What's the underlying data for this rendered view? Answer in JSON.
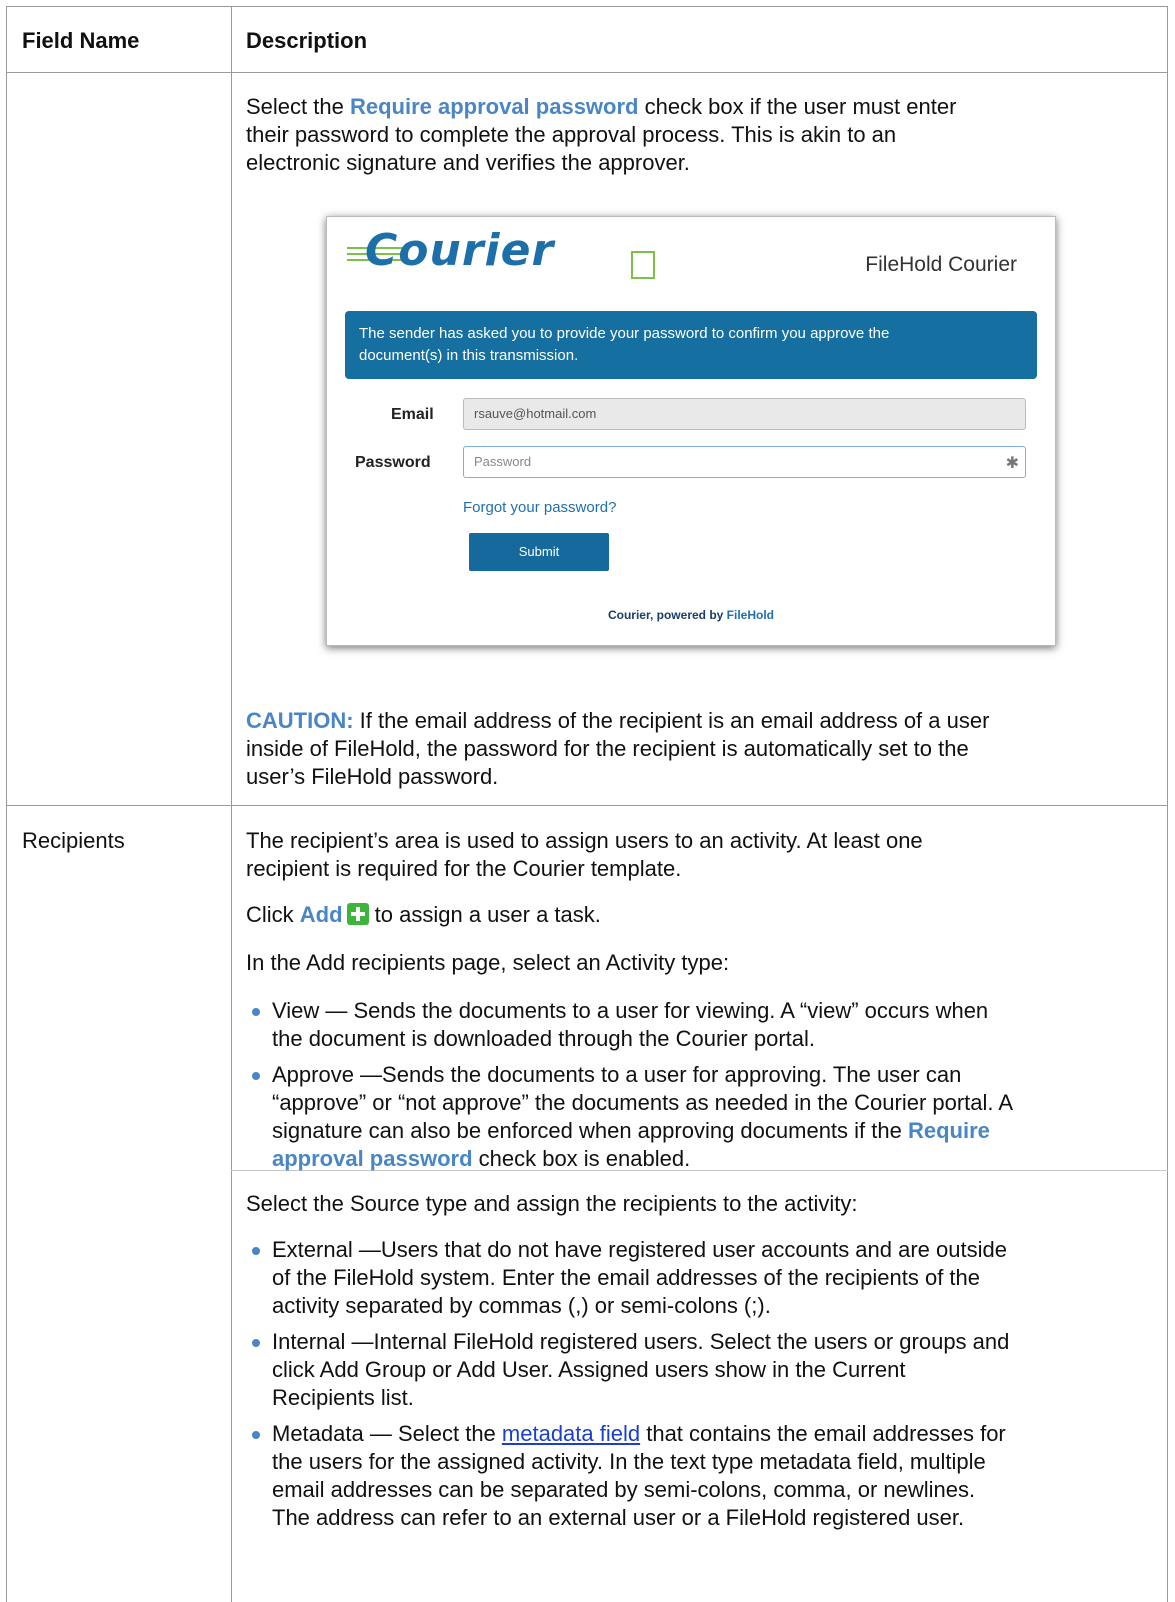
{
  "header": {
    "col1": "Field Name",
    "col2": "Description"
  },
  "row1": {
    "p1_pre": "Select the ",
    "p1_b1": "Require approval password",
    "p1_post1": " check box if the user must enter",
    "p1_line2": "their password to complete the approval process. This is akin to an",
    "p1_line3": "electronic signature and verifies the approver.",
    "screenshot": {
      "logo": "Courier",
      "brand": "FileHold Courier",
      "banner_line1": "The sender has asked you to provide your password to confirm you approve the",
      "banner_line2": "document(s) in this transmission.",
      "email_label": "Email",
      "email_value": "rsauve@hotmail.com",
      "password_label": "Password",
      "password_placeholder": "Password",
      "forgot": "Forgot your password?",
      "submit": "Submit",
      "footer_pre": "Courier, powered by ",
      "footer_brand": "FileHold"
    },
    "caution_label": "CAUTION:",
    "caution_line1": " If the email address of the recipient is an email address of a user",
    "caution_line2": "inside of FileHold, the password for the recipient is automatically set to the",
    "caution_line3": "user’s FileHold password."
  },
  "row2": {
    "field": "Recipients",
    "p1_line1": "The recipient’s area is used to assign users to an activity. At least one",
    "p1_line2": "recipient is required for the Courier template.",
    "p2_pre": "Click ",
    "p2_b": "Add",
    "p2_post": " to assign a user a task.",
    "p3": "In the Add recipients page, select an Activity type:",
    "view_l1": "View — Sends the documents to a user for viewing. A “view” occurs when",
    "view_l2": "the document is downloaded through the Courier portal.",
    "approve_l1": "Approve —Sends the documents to a user for approving. The user can",
    "approve_l2": "“approve” or “not approve” the documents as needed in the Courier portal. A",
    "approve_l3_pre": "signature can also be enforced when approving documents if the ",
    "approve_l3_b": "Require",
    "approve_l4_b": "approval password",
    "approve_l4_post": " check box is enabled."
  },
  "row3": {
    "p1": "Select the Source type and assign the recipients to the activity:",
    "ext_l1": "External —Users that do not have registered user accounts and are outside",
    "ext_l2": "of the FileHold system. Enter the email addresses of the recipients of the",
    "ext_l3": "activity separated by commas (,) or semi-colons (;).",
    "int_l1": "Internal —Internal FileHold registered users. Select the users or groups and",
    "int_l2": "click Add Group or Add User. Assigned users show in the Current",
    "int_l3": "Recipients list.",
    "meta_pre": "Metadata — Select the ",
    "meta_link": "metadata field",
    "meta_post": " that contains the email addresses for",
    "meta_l2": "the users for the assigned activity. In the text type metadata field, multiple",
    "meta_l3": "email addresses can be separated by semi-colons, comma, or newlines.",
    "meta_l4": "The address can refer to an external user or a FileHold registered user."
  }
}
